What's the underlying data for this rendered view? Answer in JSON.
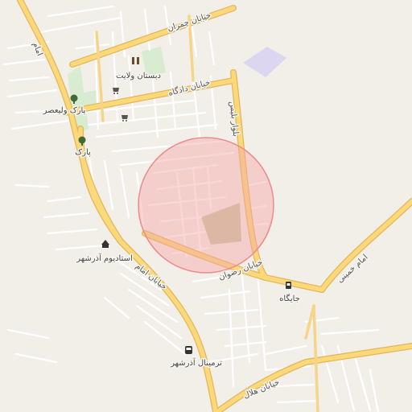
{
  "map": {
    "highlight_color": "#f4a6a6",
    "labels": {
      "street_chamran": "خیابان چمران",
      "street_velayat_school": "دبستان ولایت",
      "street_dadgah": "خیابان دادگاه",
      "park_valiasr": "پارک ولیعصر",
      "park": "پارک",
      "imam_north": "امام",
      "blvd_bales": "بلوار بلیس",
      "stadium": "استادیوم آذرشهر",
      "street_imam": "خیابان امام",
      "street_rezvan": "خیابان رضوان",
      "station": "جایگاه",
      "imam_khomeini": "امام خمینی",
      "terminal": "ترمینال آذرشهر",
      "street_helal": "خیابان هلال"
    },
    "icons": {
      "school": "school-icon",
      "park": "tree-icon",
      "stadium": "stadium-icon",
      "fuel": "fuel-icon",
      "bus": "bus-icon",
      "shop": "cart-icon"
    }
  }
}
